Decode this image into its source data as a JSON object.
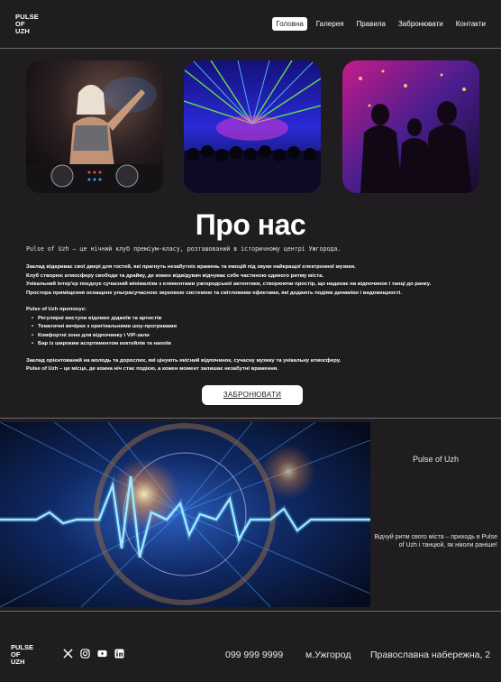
{
  "header": {
    "logo_lines": [
      "PULSE",
      "OF",
      "UZH"
    ],
    "nav": [
      {
        "label": "Головна",
        "active": true
      },
      {
        "label": "Галерея",
        "active": false
      },
      {
        "label": "Правила",
        "active": false
      },
      {
        "label": "Забронювати",
        "active": false
      },
      {
        "label": "Контакти",
        "active": false
      }
    ]
  },
  "gallery": {
    "photos": [
      {
        "icon": "dj-woman-photo"
      },
      {
        "icon": "laser-crowd-photo"
      },
      {
        "icon": "dancers-photo"
      }
    ]
  },
  "about": {
    "title": "Про нас",
    "intro": "Pulse of Uzh – це нічний клуб преміум-класу, розташований в історичному центрі Ужгорода.",
    "paragraph_lines": [
      "Заклад відкриває свої двері для гостей, які прагнуть незабутніх вражень та емоцій під звуки найкращої електронної музики.",
      " Клуб створює атмосферу свободи та драйву, де кожен відвідувач відчуває себе частиною єдиного ритму міста.",
      "Унікальний інтер'єр поєднує сучасний мінімалізм з елементами ужгородської автентики, створюючи простір, що надихає на відпочинок і танці до ранку.",
      "Простора приміщення оснащене ультрасучасною звуковою системою та світловими ефектами, які додають подіям динаміки і видовищності."
    ],
    "offers_title": "Pulse of Uzh пропонує:",
    "offers": [
      "Регулярні виступи відомих діджеїв та артистів",
      "Тематичні вечірки з оригінальними шоу-програмами",
      "Комфортні зони для відпочинку і VIP-зали",
      "Бар із широким асортиментом коктейлів та напоїв"
    ],
    "closing_lines": [
      "Заклад орієнтований на молодь та дорослих, які цінують якісний відпочинок, сучасну музику та унікальну атмосферу.",
      "Pulse of Uzh – це місце, де кожна ніч стає подією, а кожен момент залишає незабутні враження."
    ],
    "book_button": "ЗАБРОНЮВАТИ"
  },
  "banner": {
    "icon": "heartbeat-pulse-banner",
    "side_title": "Pulse of Uzh",
    "side_text": "Відчуй ритм свого міста – приходь в Pulse of Uzh і танцюй, як ніколи раніше!"
  },
  "footer": {
    "logo_lines": [
      "PULSE",
      "OF",
      "UZH"
    ],
    "social": [
      "x-icon",
      "instagram-icon",
      "youtube-icon",
      "linkedin-icon"
    ],
    "phone": "099 999 9999",
    "city": "м.Ужгород",
    "street": "Православна набережна, 2"
  }
}
